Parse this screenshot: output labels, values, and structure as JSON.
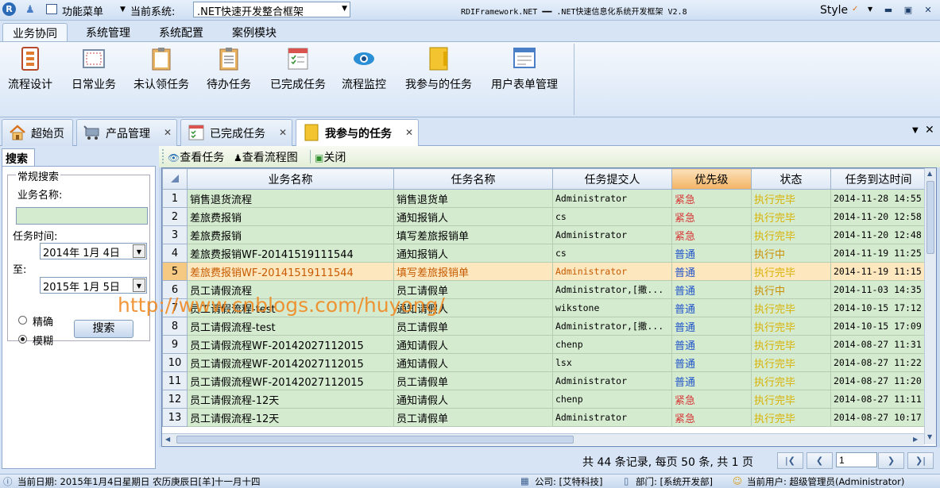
{
  "titlebar": {
    "function_menu": "功能菜单",
    "current_system_label": "当前系统:",
    "current_system_value": ".NET快速开发整合框架",
    "app_title": "RDIFramework.NET ━━ .NET快速信息化系统开发框架 V2.8",
    "style_label": "Style"
  },
  "ribbon_tabs": [
    "业务协同",
    "系统管理",
    "系统配置",
    "案例模块"
  ],
  "ribbon_buttons": [
    "流程设计",
    "日常业务",
    "未认领任务",
    "待办任务",
    "已完成任务",
    "流程监控",
    "我参与的任务",
    "用户表单管理"
  ],
  "doc_tabs": [
    "超始页",
    "产品管理",
    "已完成任务",
    "我参与的任务"
  ],
  "left": {
    "tab": "搜索",
    "group": "常规搜索",
    "biz_name_label": "业务名称:",
    "biz_name_value": "",
    "task_time_label": "任务时间:",
    "date_from": "2014年 1月 4日",
    "to_label": "至:",
    "date_to": "2015年 1月 5日",
    "exact_label": "精确",
    "fuzzy_label": "模糊",
    "search_button": "搜索"
  },
  "toolbar": {
    "view_task": "查看任务",
    "view_flow": "查看流程图",
    "close": "关闭"
  },
  "grid": {
    "columns": [
      "业务名称",
      "任务名称",
      "任务提交人",
      "优先级",
      "状态",
      "任务到达时间"
    ],
    "rows": [
      {
        "no": "1",
        "biz": "销售退货流程",
        "task": "销售退货单",
        "submitter": "Administrator",
        "priority": "紧急",
        "status": "执行完毕",
        "time": "2014-11-28 14:55"
      },
      {
        "no": "2",
        "biz": "差旅费报销",
        "task": "通知报销人",
        "submitter": "cs",
        "priority": "紧急",
        "status": "执行完毕",
        "time": "2014-11-20 12:58"
      },
      {
        "no": "3",
        "biz": "差旅费报销",
        "task": "填写差旅报销单",
        "submitter": "Administrator",
        "priority": "紧急",
        "status": "执行完毕",
        "time": "2014-11-20 12:48"
      },
      {
        "no": "4",
        "biz": "差旅费报销WF-20141519111544",
        "task": "通知报销人",
        "submitter": "cs",
        "priority": "普通",
        "status": "执行中",
        "time": "2014-11-19 11:25"
      },
      {
        "no": "5",
        "biz": "差旅费报销WF-20141519111544",
        "task": "填写差旅报销单",
        "submitter": "Administrator",
        "priority": "普通",
        "status": "执行完毕",
        "time": "2014-11-19 11:15"
      },
      {
        "no": "6",
        "biz": "员工请假流程",
        "task": "员工请假单",
        "submitter": "Administrator,[撒...",
        "priority": "普通",
        "status": "执行中",
        "time": "2014-11-03 14:35"
      },
      {
        "no": "7",
        "biz": "员工请假流程-test",
        "task": "通知请假人",
        "submitter": "wikstone",
        "priority": "普通",
        "status": "执行完毕",
        "time": "2014-10-15 17:12"
      },
      {
        "no": "8",
        "biz": "员工请假流程-test",
        "task": "员工请假单",
        "submitter": "Administrator,[撒...",
        "priority": "普通",
        "status": "执行完毕",
        "time": "2014-10-15 17:09"
      },
      {
        "no": "9",
        "biz": "员工请假流程WF-20142027112015",
        "task": "通知请假人",
        "submitter": "chenp",
        "priority": "普通",
        "status": "执行完毕",
        "time": "2014-08-27 11:31"
      },
      {
        "no": "10",
        "biz": "员工请假流程WF-20142027112015",
        "task": "通知请假人",
        "submitter": "lsx",
        "priority": "普通",
        "status": "执行完毕",
        "time": "2014-08-27 11:22"
      },
      {
        "no": "11",
        "biz": "员工请假流程WF-20142027112015",
        "task": "员工请假单",
        "submitter": "Administrator",
        "priority": "普通",
        "status": "执行完毕",
        "time": "2014-08-27 11:20"
      },
      {
        "no": "12",
        "biz": "员工请假流程-12天",
        "task": "通知请假人",
        "submitter": "chenp",
        "priority": "紧急",
        "status": "执行完毕",
        "time": "2014-08-27 11:11"
      },
      {
        "no": "13",
        "biz": "员工请假流程-12天",
        "task": "员工请假单",
        "submitter": "Administrator",
        "priority": "紧急",
        "status": "执行完毕",
        "time": "2014-08-27 10:17"
      }
    ],
    "selected_row": "5"
  },
  "pager": {
    "summary": "共 44 条记录, 每页 50 条, 共 1 页",
    "current_page": "1"
  },
  "statusbar": {
    "date": "当前日期: 2015年1月4日星期日 农历庚辰日[羊]十一月十四",
    "company": "公司: [艾特科技]",
    "dept": "部门: [系统开发部]",
    "user": "当前用户: 超级管理员(Administrator)"
  },
  "watermark": "http://www.cnblogs.com/huyong/",
  "colors": {
    "urgent": "#d63838",
    "normal": "#2255c8",
    "done": "#d7b100",
    "running": "#c98f00",
    "row_bg": "#d5ebd0",
    "selected_bg": "#fde7bf"
  }
}
